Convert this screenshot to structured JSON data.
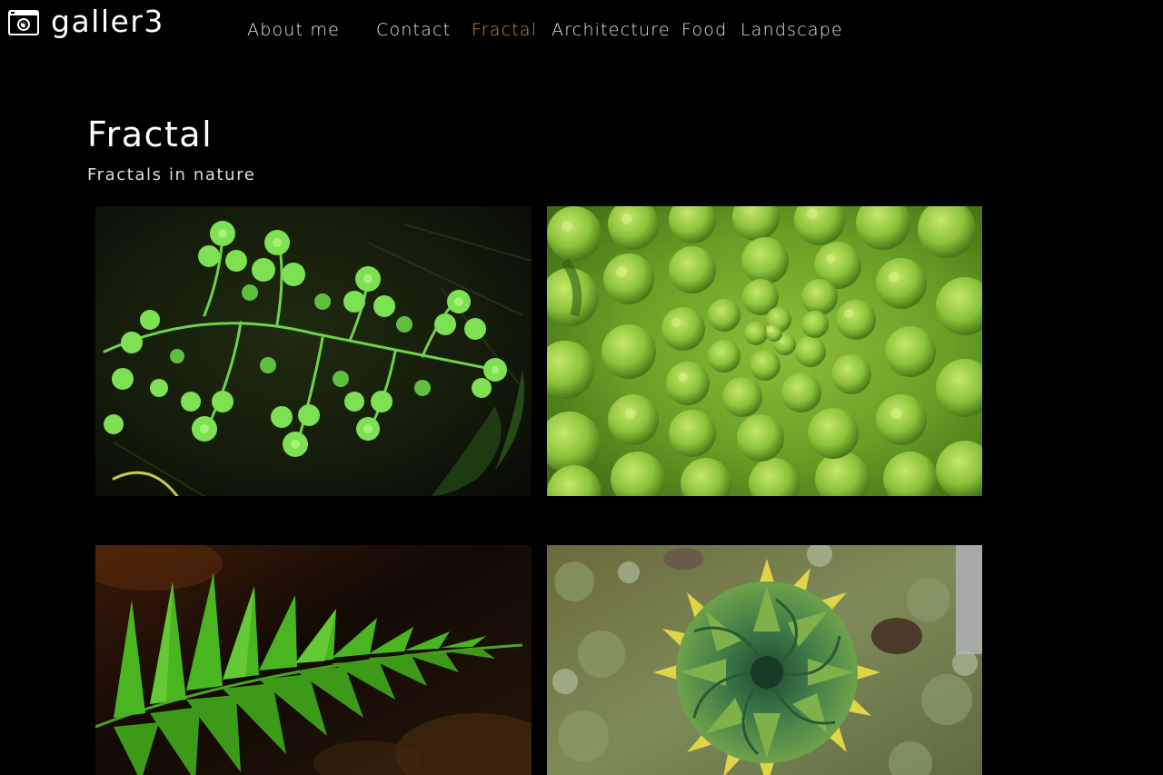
{
  "brand": {
    "name": "galler3",
    "icon": "camera-icon"
  },
  "nav": {
    "items": [
      {
        "label": "About me",
        "active": false
      },
      {
        "label": "Contact",
        "active": false
      },
      {
        "label": "Fractal",
        "active": true
      },
      {
        "label": "Architecture",
        "active": false
      },
      {
        "label": "Food",
        "active": false
      },
      {
        "label": "Landscape",
        "active": false
      }
    ],
    "active_color": "#d48a4a"
  },
  "page": {
    "title": "Fractal",
    "subtitle": "Fractals in nature"
  },
  "gallery": {
    "images": [
      {
        "subject": "fractal-fern-leaf"
      },
      {
        "subject": "romanesco-broccoli"
      },
      {
        "subject": "fern-frond"
      },
      {
        "subject": "spiral-aloe"
      }
    ]
  },
  "colors": {
    "background": "#000000",
    "text": "#ffffff"
  }
}
